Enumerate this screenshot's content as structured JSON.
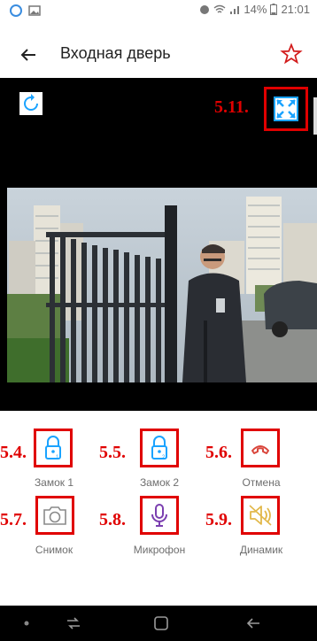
{
  "status_bar": {
    "battery": "14%",
    "time": "21:01"
  },
  "app_bar": {
    "title": "Входная дверь",
    "back_icon": "arrow-left-icon",
    "favorite_icon": "star-outline-icon"
  },
  "video": {
    "rotate_icon": "refresh-icon",
    "fullscreen_icon": "expand-icon",
    "fullscreen_annotation": "5.11."
  },
  "controls": [
    {
      "id": "lock1",
      "annotation": "5.4.",
      "label": "Замок 1",
      "icon": "lock-1-icon"
    },
    {
      "id": "lock2",
      "annotation": "5.5.",
      "label": "Замок 2",
      "icon": "lock-2-icon"
    },
    {
      "id": "cancel",
      "annotation": "5.6.",
      "label": "Отмена",
      "icon": "hangup-icon"
    },
    {
      "id": "snapshot",
      "annotation": "5.7.",
      "label": "Снимок",
      "icon": "camera-icon"
    },
    {
      "id": "mic",
      "annotation": "5.8.",
      "label": "Микрофон",
      "icon": "microphone-icon"
    },
    {
      "id": "speaker",
      "annotation": "5.9.",
      "label": "Динамик",
      "icon": "speaker-muted-icon"
    }
  ],
  "colors": {
    "annotation_red": "#e00000",
    "accent_blue": "#1aa3ff",
    "hangup_red": "#d9453b",
    "mic_purple": "#7b3fb0",
    "speaker_gold": "#e2b84a"
  }
}
